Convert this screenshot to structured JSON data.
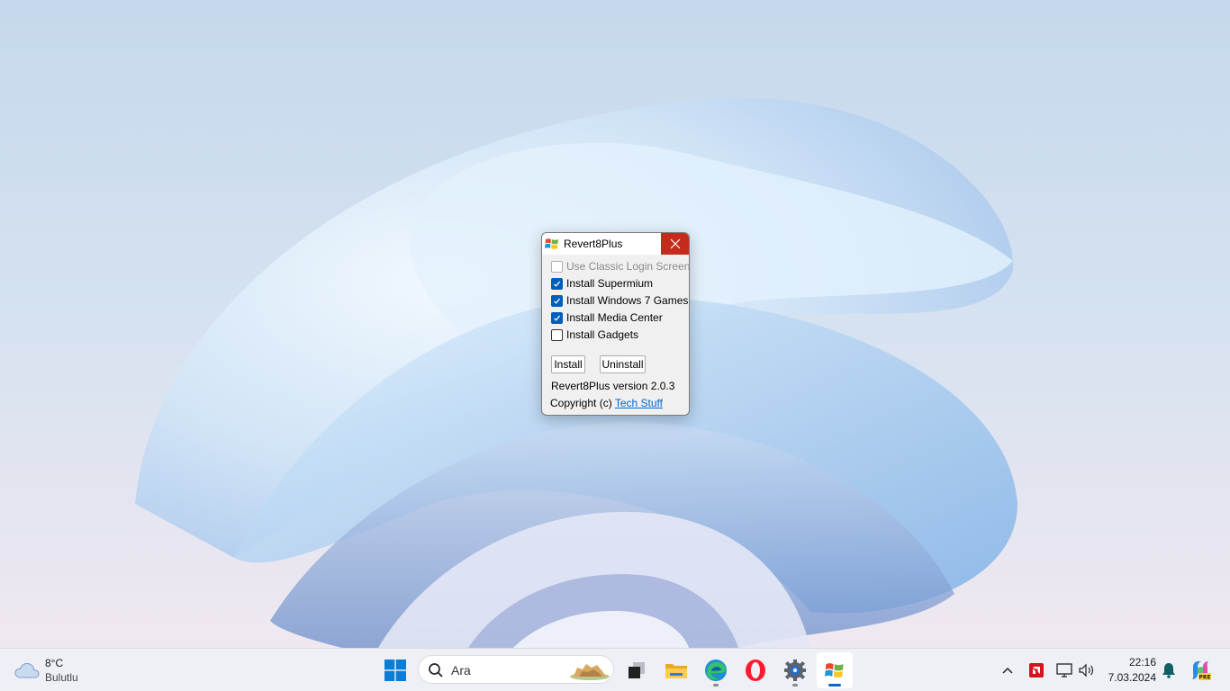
{
  "dialog": {
    "title": "Revert8Plus",
    "options": [
      {
        "label": "Use Classic Login Screen",
        "checked": false,
        "disabled": true
      },
      {
        "label": "Install Supermium",
        "checked": true,
        "disabled": false
      },
      {
        "label": "Install Windows 7 Games",
        "checked": true,
        "disabled": false
      },
      {
        "label": "Install Media Center",
        "checked": true,
        "disabled": false
      },
      {
        "label": "Install Gadgets",
        "checked": false,
        "disabled": false
      }
    ],
    "install_label": "Install",
    "uninstall_label": "Uninstall",
    "version_text": "Revert8Plus version 2.0.3",
    "copyright_prefix": "Copyright (c) ",
    "copyright_link": "Tech Stuff"
  },
  "taskbar": {
    "weather": {
      "temp": "8°C",
      "desc": "Bulutlu",
      "icon": "cloud-icon"
    },
    "search_placeholder": "Ara",
    "apps": [
      {
        "name": "start-button",
        "icon": "windows-logo-icon"
      },
      {
        "name": "task-view",
        "icon": "task-view-icon"
      },
      {
        "name": "file-explorer",
        "icon": "folder-icon"
      },
      {
        "name": "edge",
        "icon": "edge-icon",
        "running": true
      },
      {
        "name": "opera",
        "icon": "opera-icon"
      },
      {
        "name": "settings",
        "icon": "gear-icon",
        "running": true
      },
      {
        "name": "revert8plus",
        "icon": "windows-flag-icon",
        "active": true
      }
    ],
    "clock": {
      "time": "22:16",
      "date": "7.03.2024"
    },
    "colors": {
      "accent": "#005fb8",
      "close": "#c42b1c",
      "link": "#0066cc"
    }
  }
}
